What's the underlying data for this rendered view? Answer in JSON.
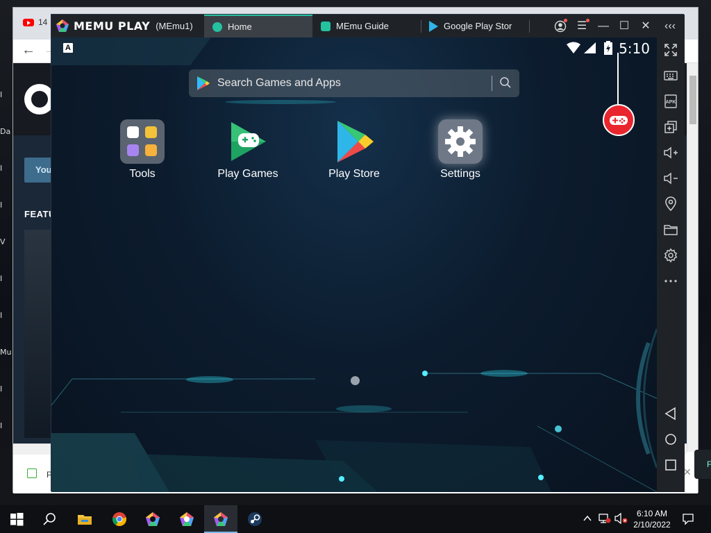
{
  "desktop": {
    "icon_labels": [
      "I",
      "Da",
      "I",
      "I",
      "V",
      "I",
      "I",
      "Mu",
      "I",
      "I"
    ]
  },
  "browser": {
    "tab_label": "14",
    "steam_button": "You",
    "featured_label": "FEATU",
    "status_text": "P",
    "side_tooltip_text": "F",
    "side_close": "✕"
  },
  "memu": {
    "brand": "MEMU PLAY",
    "instance": "(MEmu1)",
    "tabs": [
      {
        "label": "Home",
        "icon": "memu-home-icon"
      },
      {
        "label": "MEmu Guide",
        "icon": "guide-icon"
      },
      {
        "label": "Google Play Stor",
        "icon": "play-store-icon"
      }
    ],
    "title_controls": [
      "account-icon",
      "menu-icon",
      "minimize-icon",
      "maximize-icon",
      "close-icon",
      "collapse-sidebar-icon"
    ],
    "status_bar": {
      "clock": "5:10",
      "badge": "A"
    },
    "search": {
      "placeholder": "Search Games and Apps"
    },
    "apps": [
      {
        "label": "Tools",
        "icon": "tools-folder-icon"
      },
      {
        "label": "Play Games",
        "icon": "play-games-icon"
      },
      {
        "label": "Play Store",
        "icon": "play-store-icon"
      },
      {
        "label": "Settings",
        "icon": "settings-gear-icon"
      }
    ],
    "sidebar": [
      "fullscreen-icon",
      "keyboard-icon",
      "apk-icon",
      "multi-window-icon",
      "volume-up-icon",
      "volume-down-icon",
      "location-icon",
      "folder-icon",
      "settings-icon",
      "more-icon",
      "back-icon",
      "home-icon",
      "recents-icon"
    ],
    "apk_label": "APK",
    "accent_color": "#25c2a0",
    "gamepad_color": "#e9262d"
  },
  "taskbar": {
    "apps": [
      "start-icon",
      "search-icon",
      "file-explorer-icon",
      "chrome-icon",
      "memu-icon",
      "memu-multi-icon",
      "memu-active-icon",
      "steam-icon"
    ],
    "time": "6:10 AM",
    "date": "2/10/2022",
    "tray": [
      "chevron-up-icon",
      "network-icon",
      "volume-muted-icon",
      "notification-icon"
    ]
  }
}
